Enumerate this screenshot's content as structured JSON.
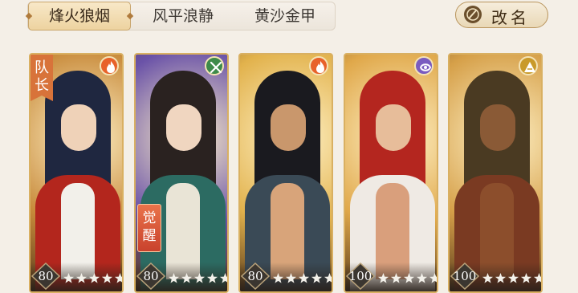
{
  "tabs": [
    {
      "label": "烽火狼烟",
      "active": true
    },
    {
      "label": "风平浪静",
      "active": false
    },
    {
      "label": "黄沙金甲",
      "active": false
    }
  ],
  "rename_button": {
    "label": "改名",
    "icon": "brush-icon"
  },
  "cards": [
    {
      "level": "80",
      "stars": 5,
      "element": "fire-icon",
      "badge": "队长",
      "palette": {
        "bg": "#c88a3a",
        "hair": "#1f2740",
        "face": "#efd2b8",
        "body": "#b3261d",
        "chest": "#f2f0ea"
      }
    },
    {
      "level": "80",
      "stars": 5,
      "element": "wind-icon",
      "badge": "觉醒",
      "palette": {
        "bg": "#6a52a8",
        "hair": "#2a2220",
        "face": "#f0d6c0",
        "body": "#2c6b62",
        "chest": "#e9e4d6"
      }
    },
    {
      "level": "80",
      "stars": 5,
      "element": "fire-icon",
      "badge": "",
      "palette": {
        "bg": "#e2b24c",
        "hair": "#1a1a1f",
        "face": "#c9976c",
        "body": "#3a4a56",
        "chest": "#d8a47a"
      }
    },
    {
      "level": "100",
      "stars": 5,
      "element": "water-icon",
      "badge": "",
      "palette": {
        "bg": "#e0a84a",
        "hair": "#b4261f",
        "face": "#e7bd9a",
        "body": "#efeae4",
        "chest": "#d99f7c"
      }
    },
    {
      "level": "100",
      "stars": 5,
      "element": "earth-icon",
      "badge": "",
      "palette": {
        "bg": "#d6a049",
        "hair": "#4a3a22",
        "face": "#8a5a36",
        "body": "#7a3a22",
        "chest": "#8c4e2c"
      }
    }
  ],
  "colors": {
    "fire": "#e8622a",
    "wind": "#3e8a4a",
    "water": "#7a5cc0",
    "earth": "#c99a2a",
    "star": "#f3f1ea",
    "level_bg": "#3b3630"
  }
}
